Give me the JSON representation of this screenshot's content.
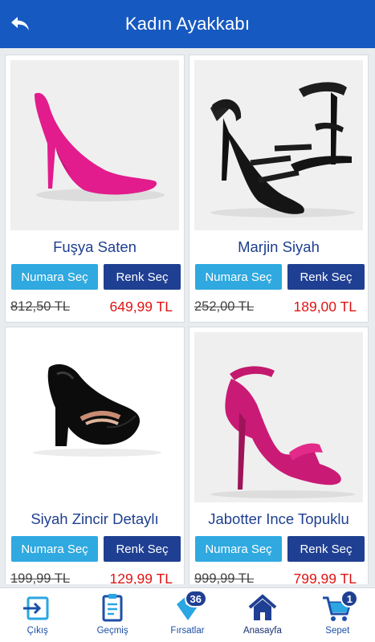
{
  "header": {
    "title": "Kadın Ayakkabı"
  },
  "products": [
    {
      "name": "Fuşya Saten",
      "size_btn": "Numara Seç",
      "color_btn": "Renk Seç",
      "old_price": "812,50 TL",
      "price": "649,99 TL"
    },
    {
      "name": "Marjin Siyah",
      "size_btn": "Numara Seç",
      "color_btn": "Renk Seç",
      "old_price": "252,00 TL",
      "price": "189,00 TL"
    },
    {
      "name": "Siyah Zincir Detaylı",
      "size_btn": "Numara Seç",
      "color_btn": "Renk Seç",
      "old_price": "199,99 TL",
      "price": "129,99 TL"
    },
    {
      "name": "Jabotter Ince Topuklu",
      "size_btn": "Numara Seç",
      "color_btn": "Renk Seç",
      "old_price": "999,99 TL",
      "price": "799,99 TL"
    }
  ],
  "tabbar": {
    "items": [
      {
        "label": "Çıkış",
        "icon": "logout-icon"
      },
      {
        "label": "Geçmiş",
        "icon": "clipboard-icon"
      },
      {
        "label": "Fırsatlar",
        "icon": "tag-icon",
        "badge": "36"
      },
      {
        "label": "Anasayfa",
        "icon": "home-icon"
      },
      {
        "label": "Sepet",
        "icon": "cart-icon",
        "badge": "1"
      }
    ]
  },
  "colors": {
    "primary": "#1659c0",
    "navy": "#1f3f92",
    "sky": "#2fa9e0",
    "price_red": "#e01414"
  }
}
